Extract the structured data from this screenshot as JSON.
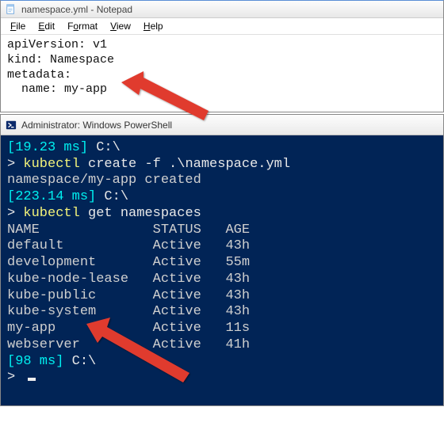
{
  "notepad": {
    "title": "namespace.yml - Notepad",
    "menu": {
      "file": "File",
      "edit": "Edit",
      "format": "Format",
      "view": "View",
      "help": "Help"
    },
    "lines": {
      "l1": "apiVersion: v1",
      "l2": "kind: Namespace",
      "l3": "metadata:",
      "l4": "  name: my-app"
    }
  },
  "powershell": {
    "title": "Administrator: Windows PowerShell",
    "lines": {
      "t1_time": "[19.23 ms]",
      "t1_path": " C:\\",
      "p1_prompt": "> ",
      "p1_cmd": "kubectl",
      "p1_args": " create -f .\\namespace.yml",
      "out1": "namespace/my-app created",
      "t2_time": "[223.14 ms]",
      "t2_path": " C:\\",
      "p2_prompt": "> ",
      "p2_cmd": "kubectl",
      "p2_args": " get namespaces",
      "hdr": "NAME              STATUS   AGE",
      "r1": "default           Active   43h",
      "r2": "development       Active   55m",
      "r3": "kube-node-lease   Active   43h",
      "r4": "kube-public       Active   43h",
      "r5": "kube-system       Active   43h",
      "r6": "my-app            Active   11s",
      "r7": "webserver         Active   41h",
      "t3_time": "[98 ms]",
      "t3_path": " C:\\",
      "p3_prompt": "> "
    }
  },
  "colors": {
    "arrow": "#e03a2f"
  }
}
